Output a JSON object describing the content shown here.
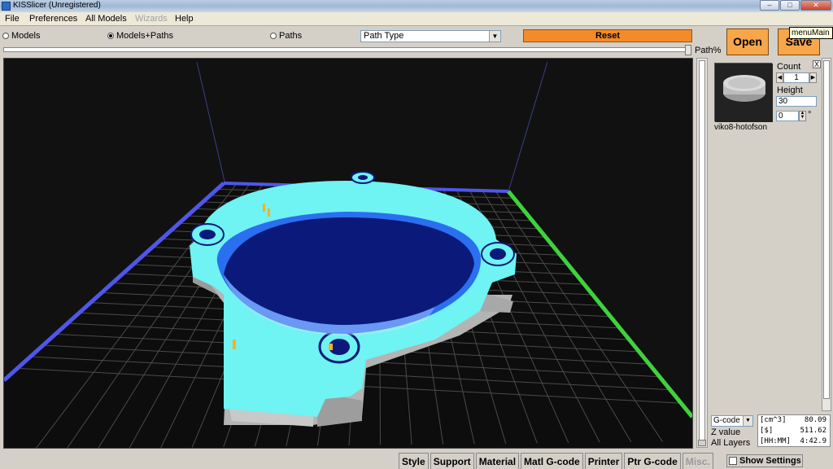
{
  "window": {
    "title": "KISSlicer (Unregistered)",
    "controls": [
      "–",
      "□",
      "✕"
    ]
  },
  "menu": [
    {
      "label": "File",
      "enabled": true
    },
    {
      "label": "Preferences",
      "enabled": true
    },
    {
      "label": "All Models",
      "enabled": true
    },
    {
      "label": "Wizards",
      "enabled": false
    },
    {
      "label": "Help",
      "enabled": true
    }
  ],
  "view_mode": {
    "options": [
      "Models",
      "Models+Paths",
      "Paths"
    ],
    "selected": "Models+Paths"
  },
  "path_type": {
    "selected": "Path Type"
  },
  "reset_label": "Reset",
  "path_pct_label": "Path%",
  "path_pct": 1.0,
  "open_label": "Open",
  "save_label": "Save",
  "tooltip": "menuMain",
  "model": {
    "name": "viko8-hotofson",
    "count_label": "Count",
    "count": "1",
    "height_label": "Height",
    "height": "30",
    "rotation": "0",
    "rotation_unit": "°",
    "close": "X"
  },
  "bottom": {
    "gcode_select": "G-code",
    "z_value_label": "Z value",
    "all_layers_label": "All Layers",
    "stats": [
      {
        "key": "[cm^3]",
        "value": "80.09"
      },
      {
        "key": "[$]",
        "value": "511.62"
      },
      {
        "key": "[HH:MM]",
        "value": "4:42.9"
      }
    ]
  },
  "tabs": [
    {
      "label": "Style",
      "enabled": true
    },
    {
      "label": "Support",
      "enabled": true
    },
    {
      "label": "Material",
      "enabled": true
    },
    {
      "label": "Matl G-code",
      "enabled": true
    },
    {
      "label": "Printer",
      "enabled": true
    },
    {
      "label": "Ptr G-code",
      "enabled": true
    },
    {
      "label": "Misc.",
      "enabled": false
    }
  ],
  "show_settings_label": "Show Settings",
  "colors": {
    "accent_button": "#f48b2a",
    "model_cyan": "#6ff3f3",
    "model_inner": "#0b1a7a",
    "support_gray": "#b9b9b9",
    "bed_grid": "#5a5a5a",
    "x_axis": "#5157f0",
    "y_axis": "#3fd23c"
  }
}
